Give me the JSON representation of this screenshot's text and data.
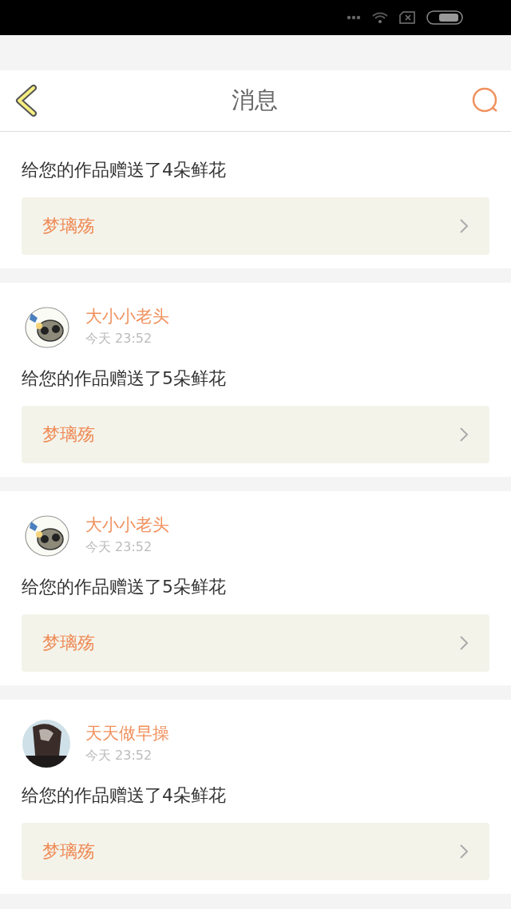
{
  "header": {
    "title": "消息"
  },
  "messages": [
    {
      "text": "给您的作品赠送了4朵鲜花",
      "work": "梦璃殇"
    },
    {
      "sender": "大小小老头",
      "time": "今天 23:52",
      "kind": "cartoon",
      "text": "给您的作品赠送了5朵鲜花",
      "work": "梦璃殇"
    },
    {
      "sender": "大小小老头",
      "time": "今天 23:52",
      "kind": "cartoon",
      "text": "给您的作品赠送了5朵鲜花",
      "work": "梦璃殇"
    },
    {
      "sender": "天天做早操",
      "time": "今天 23:52",
      "kind": "picture",
      "text": "给您的作品赠送了4朵鲜花",
      "work": "梦璃殇"
    }
  ]
}
